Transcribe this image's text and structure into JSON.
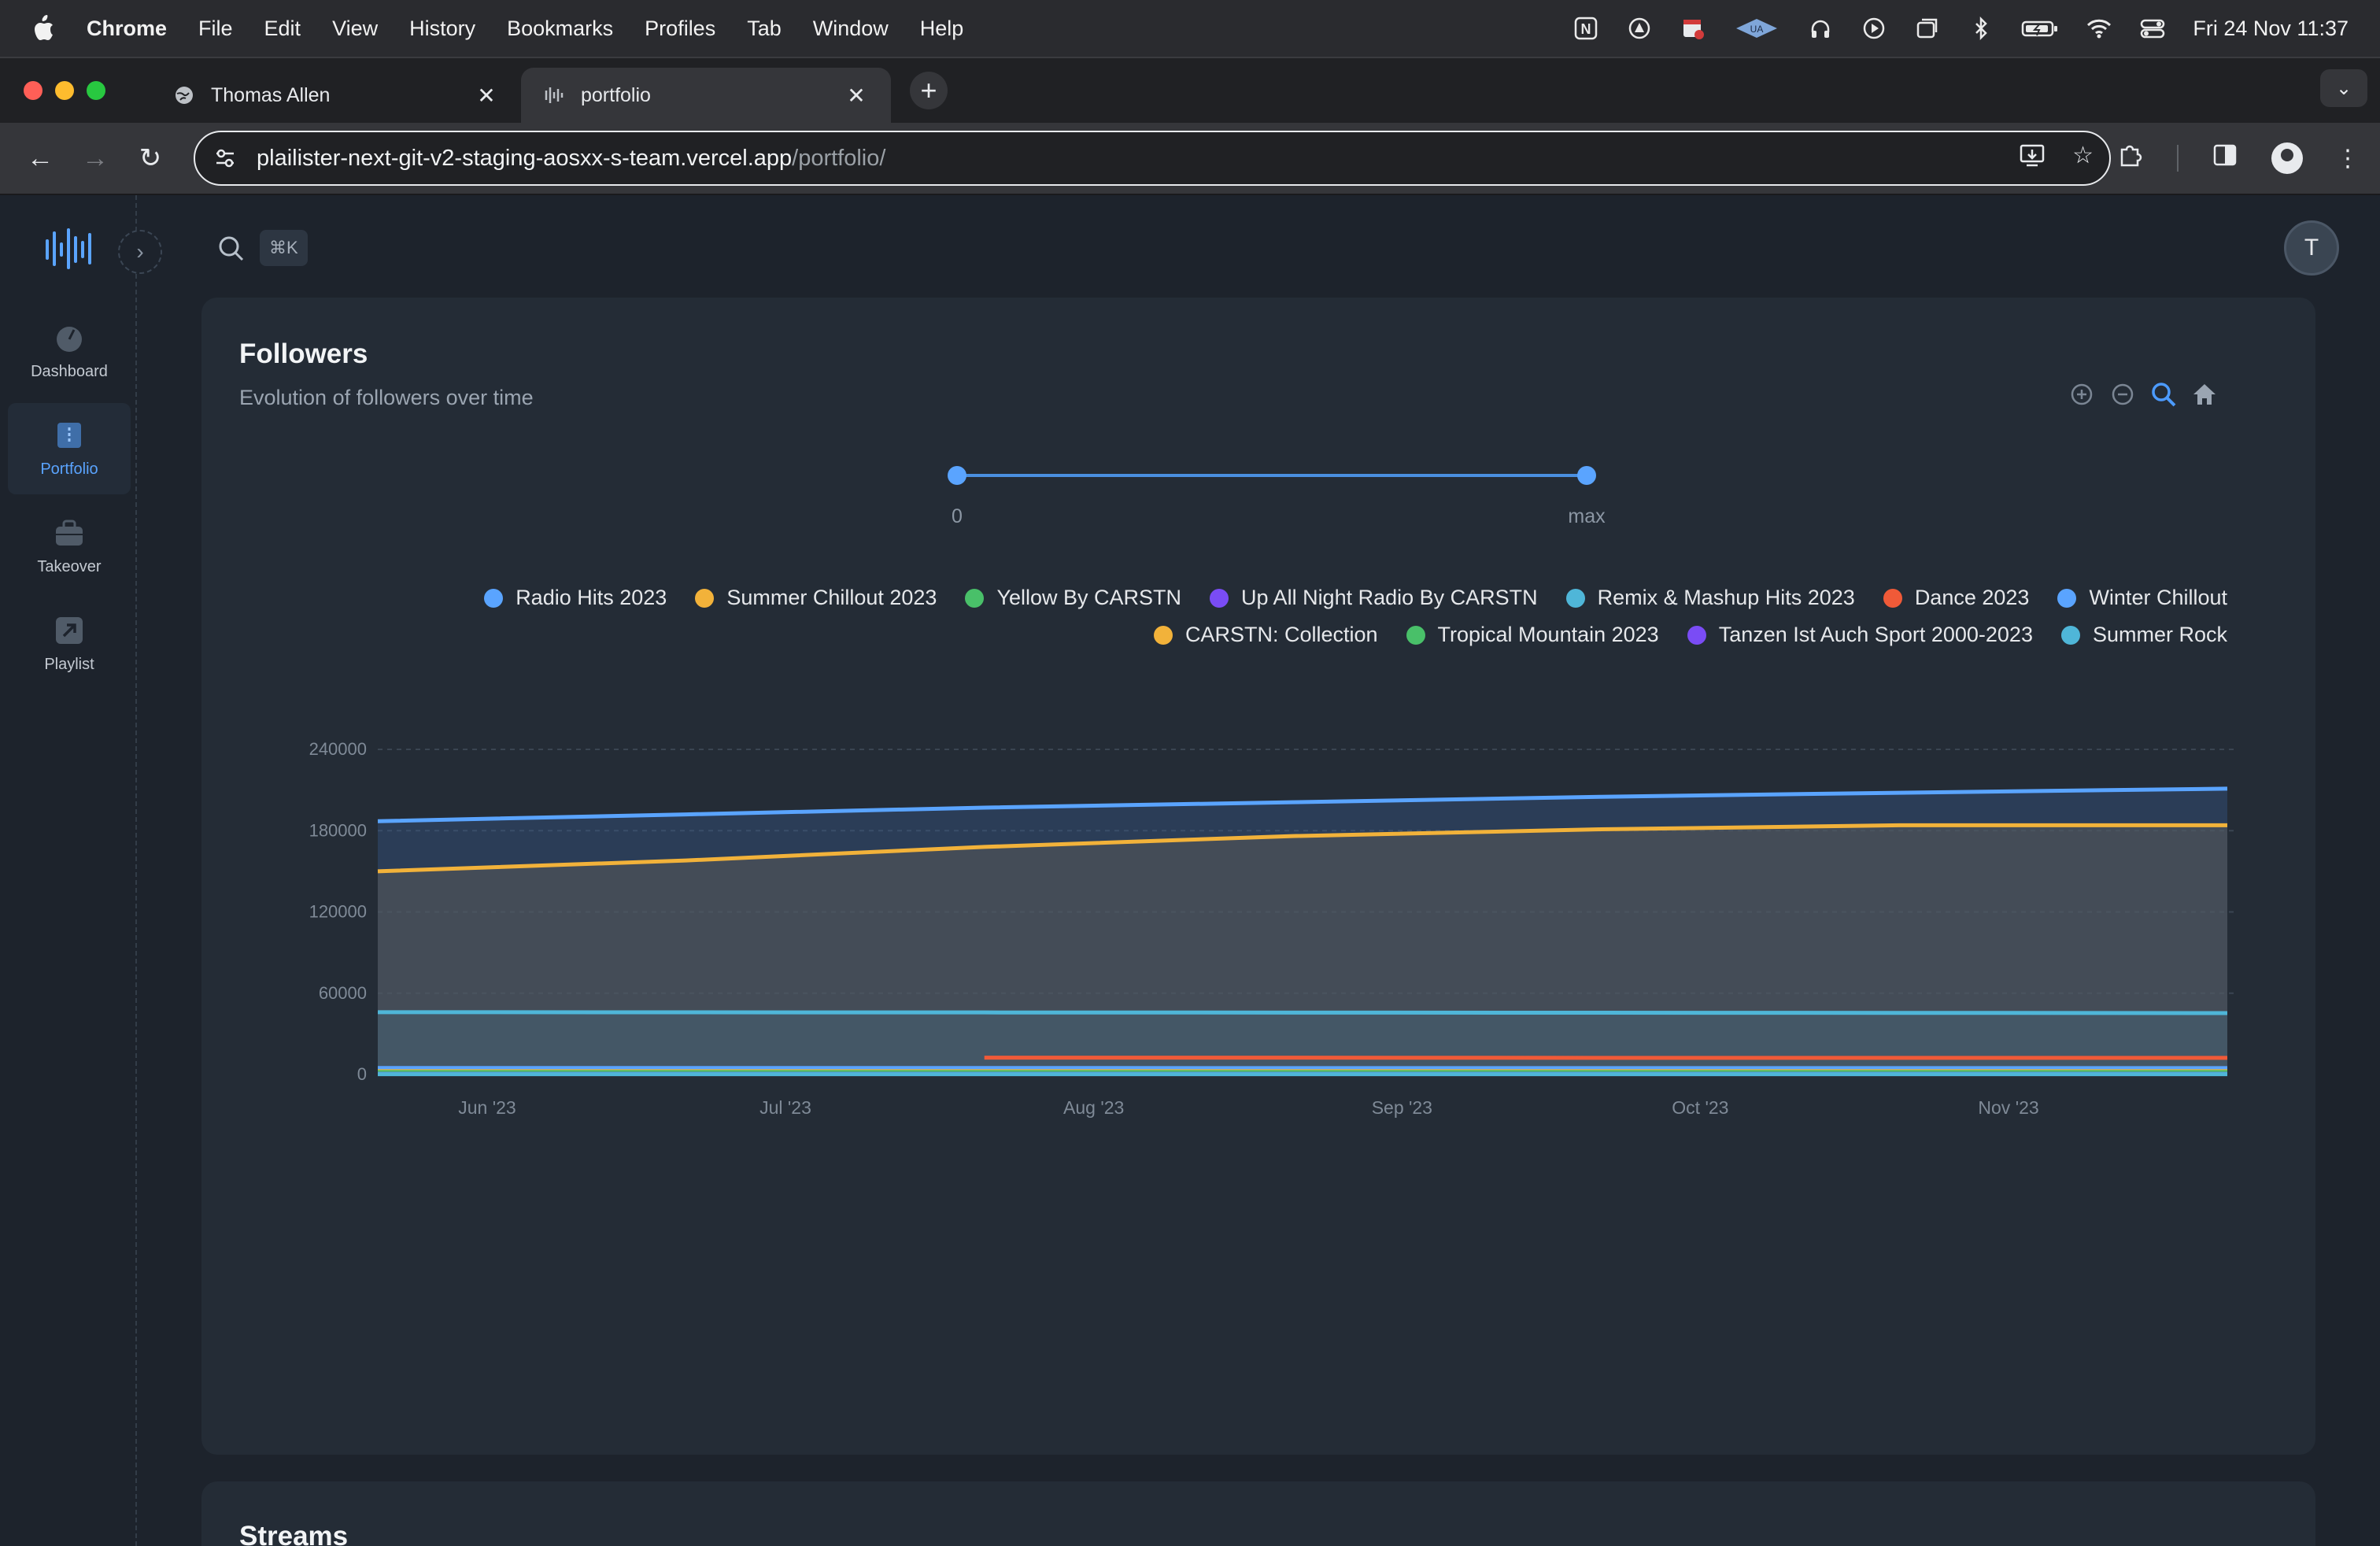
{
  "menubar": {
    "app_name": "Chrome",
    "items": [
      "File",
      "Edit",
      "View",
      "History",
      "Bookmarks",
      "Profiles",
      "Tab",
      "Window",
      "Help"
    ],
    "clock": "Fri 24 Nov  11:37"
  },
  "tabs": [
    {
      "title": "Thomas Allen",
      "icon": "globe-icon",
      "active": false
    },
    {
      "title": "portfolio",
      "icon": "audio-wave-icon",
      "active": true
    }
  ],
  "toolbar": {
    "url_host": "plailister-next-git-v2-staging-aosxx-s-team.vercel.app",
    "url_path": "/portfolio/"
  },
  "app": {
    "search_shortcut": "⌘K",
    "user_initial": "T",
    "nav": [
      {
        "label": "Dashboard",
        "icon": "gauge-icon",
        "active": false
      },
      {
        "label": "Portfolio",
        "icon": "portfolio-icon",
        "active": true
      },
      {
        "label": "Takeover",
        "icon": "briefcase-icon",
        "active": false
      },
      {
        "label": "Playlist",
        "icon": "external-arrow-icon",
        "active": false
      }
    ]
  },
  "followers": {
    "title": "Followers",
    "subtitle": "Evolution of followers over time",
    "range_min_label": "0",
    "range_max_label": "max"
  },
  "streams": {
    "title": "Streams"
  },
  "chart_data": {
    "type": "area",
    "x_tick_labels": [
      "Jun '23",
      "Jul '23",
      "Aug '23",
      "Sep '23",
      "Oct '23",
      "Nov '23"
    ],
    "x_range": [
      "2023-05-21",
      "2023-11-23"
    ],
    "ylim": [
      0,
      240000
    ],
    "y_ticks": [
      0,
      60000,
      120000,
      180000,
      240000
    ],
    "grid": true,
    "legend_position": "top-right",
    "x": [
      "2023-05-21",
      "2023-06-21",
      "2023-07-21",
      "2023-08-21",
      "2023-09-21",
      "2023-10-21",
      "2023-11-23"
    ],
    "series": [
      {
        "name": "Radio Hits 2023",
        "color": "#5aa4ff",
        "values": [
          187000,
          192000,
          197000,
          201000,
          205000,
          208000,
          211000
        ]
      },
      {
        "name": "Summer Chillout 2023",
        "color": "#f2b23a",
        "values": [
          150000,
          158000,
          168000,
          176000,
          181000,
          184000,
          184000
        ]
      },
      {
        "name": "Yellow By CARSTN",
        "color": "#49c069",
        "values": [
          1200,
          1200,
          1300,
          1300,
          1300,
          1300,
          1300
        ]
      },
      {
        "name": "Up All Night Radio By CARSTN",
        "color": "#7a4cf5",
        "values": [
          800,
          800,
          800,
          800,
          800,
          800,
          800
        ]
      },
      {
        "name": "Remix & Mashup Hits 2023",
        "color": "#4fb6d8",
        "values": [
          46000,
          45900,
          45800,
          45700,
          45600,
          45500,
          45300
        ]
      },
      {
        "name": "Dance 2023",
        "color": "#f05a38",
        "values": [
          null,
          null,
          12400,
          12400,
          12300,
          12300,
          12300
        ]
      },
      {
        "name": "Winter Chillout",
        "color": "#5aa4ff",
        "values": [
          4800,
          4800,
          4800,
          4700,
          4700,
          4700,
          4700
        ]
      },
      {
        "name": "CARSTN: Collection",
        "color": "#f2b23a",
        "values": [
          2500,
          2500,
          2500,
          2500,
          2500,
          2500,
          2500
        ]
      },
      {
        "name": "Tropical Mountain 2023",
        "color": "#49c069",
        "values": [
          1800,
          1800,
          1800,
          1800,
          1800,
          1800,
          1800
        ]
      },
      {
        "name": "Tanzen Ist Auch Sport 2000-2023",
        "color": "#7a4cf5",
        "values": [
          400,
          400,
          400,
          400,
          400,
          400,
          400
        ]
      },
      {
        "name": "Summer Rock",
        "color": "#4fb6d8",
        "values": [
          200,
          200,
          200,
          200,
          200,
          200,
          200
        ]
      }
    ]
  }
}
